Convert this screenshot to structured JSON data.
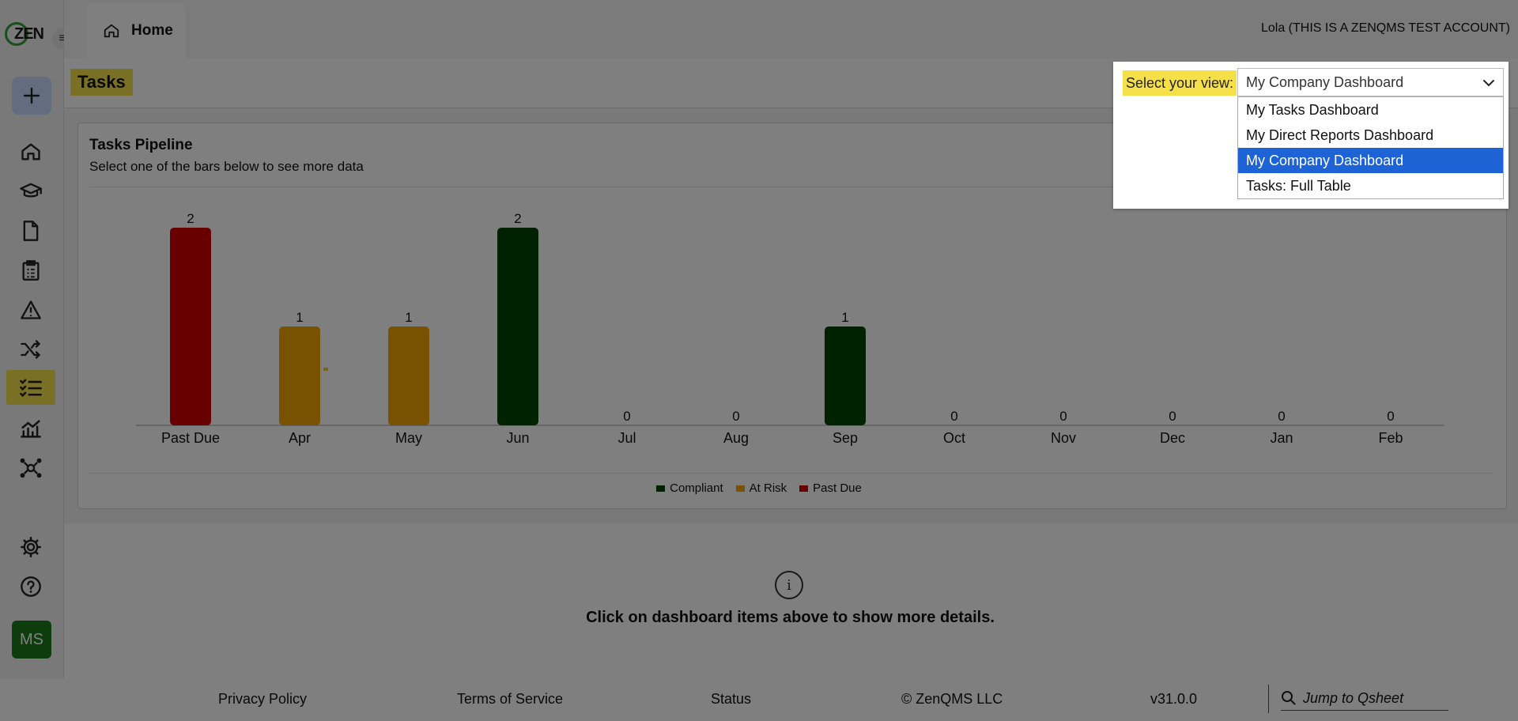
{
  "app": {
    "logo": "ZEN",
    "avatar": "MS",
    "user": "Lola (THIS IS A ZENQMS TEST ACCOUNT)"
  },
  "tabs": [
    {
      "label": "Home"
    }
  ],
  "sidebar": {
    "icons": [
      "plus-icon",
      "home-icon",
      "graduation-cap-icon",
      "document-icon",
      "clipboard-icon",
      "warning-icon",
      "shuffle-icon",
      "task-list-icon",
      "analytics-icon",
      "network-icon",
      "gear-icon",
      "help-icon"
    ],
    "active": "task-list-icon"
  },
  "page": {
    "title": "Tasks"
  },
  "view_selector": {
    "label": "Select your view:",
    "selected": "My Company Dashboard",
    "options": [
      "My Tasks Dashboard",
      "My Direct Reports Dashboard",
      "My Company Dashboard",
      "Tasks: Full Table"
    ]
  },
  "card": {
    "title": "Tasks Pipeline",
    "subtitle": "Select one of the bars below to see more data"
  },
  "chart_data": {
    "type": "bar",
    "categories": [
      "Past Due",
      "Apr",
      "May",
      "Jun",
      "Jul",
      "Aug",
      "Sep",
      "Oct",
      "Nov",
      "Dec",
      "Jan",
      "Feb"
    ],
    "values": [
      2,
      1,
      1,
      2,
      0,
      0,
      1,
      0,
      0,
      0,
      0,
      0
    ],
    "status": [
      "Past Due",
      "At Risk",
      "At Risk",
      "Compliant",
      "Compliant",
      "Compliant",
      "Compliant",
      "Compliant",
      "Compliant",
      "Compliant",
      "Compliant",
      "Compliant"
    ],
    "legend": [
      {
        "name": "Compliant",
        "color": "#004400"
      },
      {
        "name": "At Risk",
        "color": "#f0a500"
      },
      {
        "name": "Past Due",
        "color": "#d00000"
      }
    ],
    "legend_position": "bottom",
    "ylim": [
      0,
      2
    ]
  },
  "info": {
    "text": "Click on dashboard items above to show more details."
  },
  "footer": {
    "links": [
      "Privacy Policy",
      "Terms of Service",
      "Status",
      "© ZenQMS LLC",
      "v31.0.0"
    ],
    "search_placeholder": "Jump to Qsheet"
  },
  "colors": {
    "accent_yellow": "#f5e04a",
    "select_blue": "#1e63d6",
    "avatar_green": "#1b7a1b"
  }
}
